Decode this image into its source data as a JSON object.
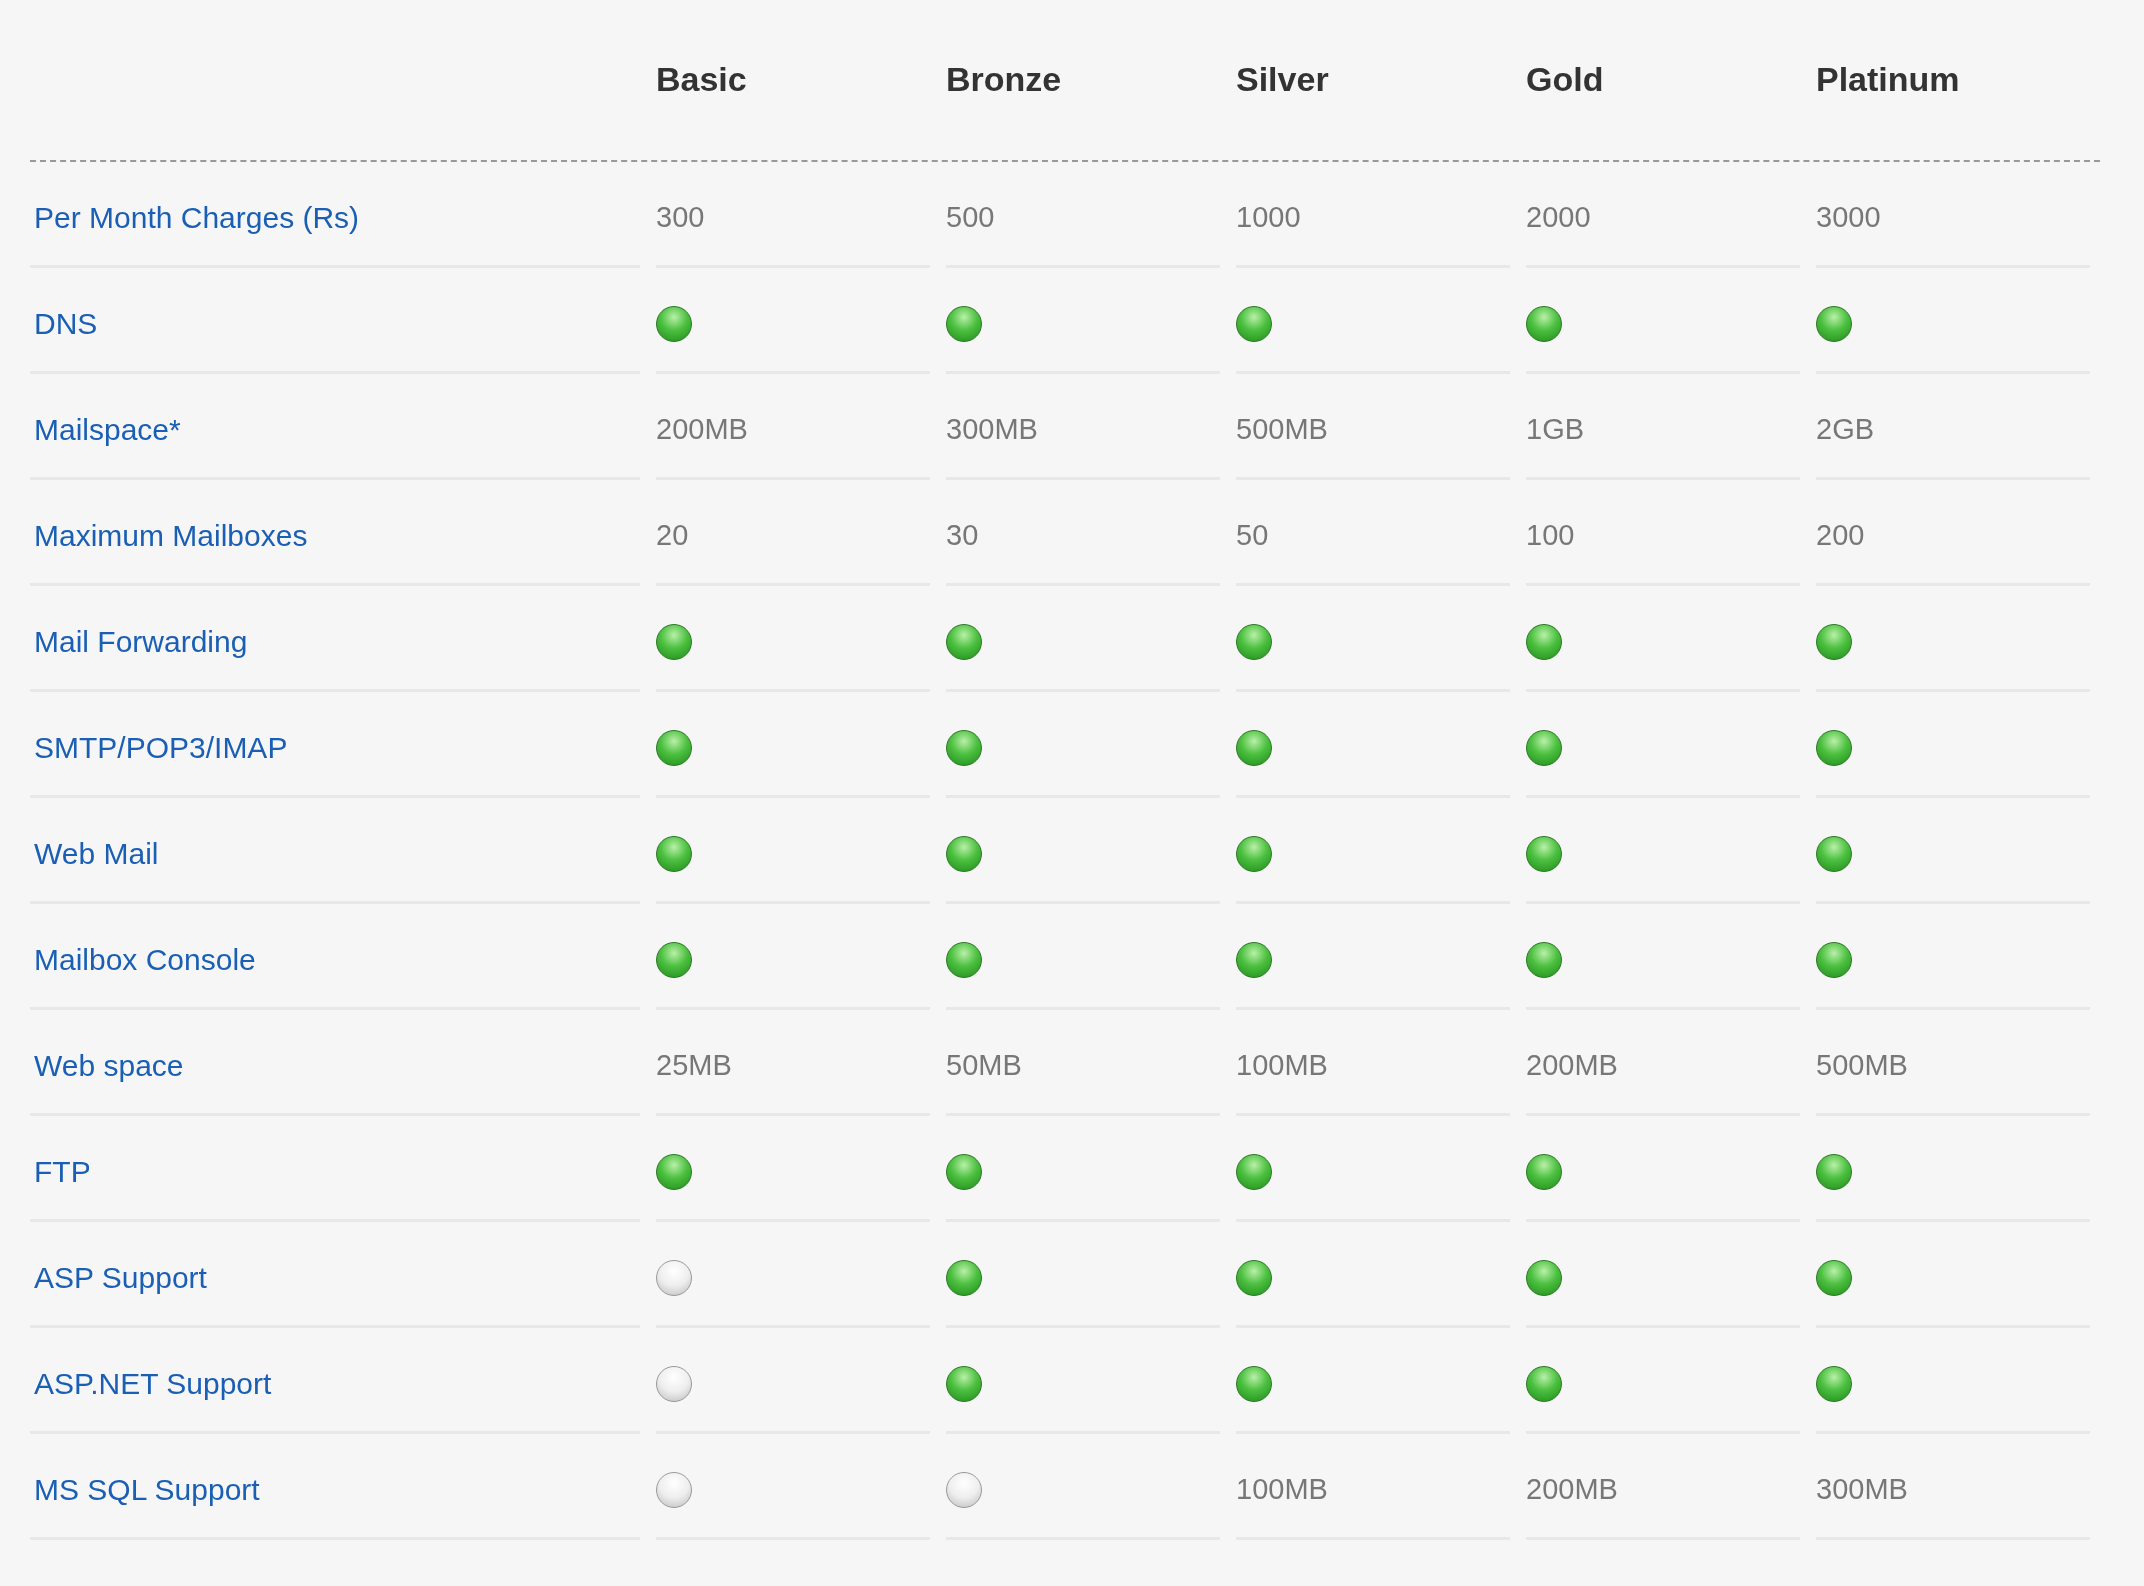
{
  "plans": [
    "Basic",
    "Bronze",
    "Silver",
    "Gold",
    "Platinum"
  ],
  "rows": [
    {
      "label": "Per Month Charges (Rs)",
      "cells": [
        {
          "kind": "text",
          "text": "300"
        },
        {
          "kind": "text",
          "text": "500"
        },
        {
          "kind": "text",
          "text": "1000"
        },
        {
          "kind": "text",
          "text": "2000"
        },
        {
          "kind": "text",
          "text": "3000"
        }
      ]
    },
    {
      "label": "DNS",
      "cells": [
        {
          "kind": "dot",
          "included": true
        },
        {
          "kind": "dot",
          "included": true
        },
        {
          "kind": "dot",
          "included": true
        },
        {
          "kind": "dot",
          "included": true
        },
        {
          "kind": "dot",
          "included": true
        }
      ]
    },
    {
      "label": "Mailspace*",
      "cells": [
        {
          "kind": "text",
          "text": "200MB"
        },
        {
          "kind": "text",
          "text": "300MB"
        },
        {
          "kind": "text",
          "text": "500MB"
        },
        {
          "kind": "text",
          "text": "1GB"
        },
        {
          "kind": "text",
          "text": "2GB"
        }
      ]
    },
    {
      "label": "Maximum Mailboxes",
      "cells": [
        {
          "kind": "text",
          "text": "20"
        },
        {
          "kind": "text",
          "text": "30"
        },
        {
          "kind": "text",
          "text": "50"
        },
        {
          "kind": "text",
          "text": "100"
        },
        {
          "kind": "text",
          "text": "200"
        }
      ]
    },
    {
      "label": "Mail Forwarding",
      "cells": [
        {
          "kind": "dot",
          "included": true
        },
        {
          "kind": "dot",
          "included": true
        },
        {
          "kind": "dot",
          "included": true
        },
        {
          "kind": "dot",
          "included": true
        },
        {
          "kind": "dot",
          "included": true
        }
      ]
    },
    {
      "label": "SMTP/POP3/IMAP",
      "cells": [
        {
          "kind": "dot",
          "included": true
        },
        {
          "kind": "dot",
          "included": true
        },
        {
          "kind": "dot",
          "included": true
        },
        {
          "kind": "dot",
          "included": true
        },
        {
          "kind": "dot",
          "included": true
        }
      ]
    },
    {
      "label": "Web Mail",
      "cells": [
        {
          "kind": "dot",
          "included": true
        },
        {
          "kind": "dot",
          "included": true
        },
        {
          "kind": "dot",
          "included": true
        },
        {
          "kind": "dot",
          "included": true
        },
        {
          "kind": "dot",
          "included": true
        }
      ]
    },
    {
      "label": "Mailbox Console",
      "cells": [
        {
          "kind": "dot",
          "included": true
        },
        {
          "kind": "dot",
          "included": true
        },
        {
          "kind": "dot",
          "included": true
        },
        {
          "kind": "dot",
          "included": true
        },
        {
          "kind": "dot",
          "included": true
        }
      ]
    },
    {
      "label": "Web space",
      "cells": [
        {
          "kind": "text",
          "text": "25MB"
        },
        {
          "kind": "text",
          "text": "50MB"
        },
        {
          "kind": "text",
          "text": "100MB"
        },
        {
          "kind": "text",
          "text": "200MB"
        },
        {
          "kind": "text",
          "text": "500MB"
        }
      ]
    },
    {
      "label": "FTP",
      "cells": [
        {
          "kind": "dot",
          "included": true
        },
        {
          "kind": "dot",
          "included": true
        },
        {
          "kind": "dot",
          "included": true
        },
        {
          "kind": "dot",
          "included": true
        },
        {
          "kind": "dot",
          "included": true
        }
      ]
    },
    {
      "label": "ASP Support",
      "cells": [
        {
          "kind": "dot",
          "included": false
        },
        {
          "kind": "dot",
          "included": true
        },
        {
          "kind": "dot",
          "included": true
        },
        {
          "kind": "dot",
          "included": true
        },
        {
          "kind": "dot",
          "included": true
        }
      ]
    },
    {
      "label": "ASP.NET Support",
      "cells": [
        {
          "kind": "dot",
          "included": false
        },
        {
          "kind": "dot",
          "included": true
        },
        {
          "kind": "dot",
          "included": true
        },
        {
          "kind": "dot",
          "included": true
        },
        {
          "kind": "dot",
          "included": true
        }
      ]
    },
    {
      "label": "MS SQL Support",
      "cells": [
        {
          "kind": "dot",
          "included": false
        },
        {
          "kind": "dot",
          "included": false
        },
        {
          "kind": "text",
          "text": "100MB"
        },
        {
          "kind": "text",
          "text": "200MB"
        },
        {
          "kind": "text",
          "text": "300MB"
        }
      ]
    }
  ]
}
